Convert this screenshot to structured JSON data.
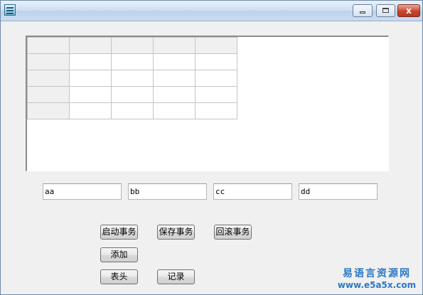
{
  "window": {
    "title": "",
    "minimize_label": "",
    "maximize_label": "",
    "close_label": "x"
  },
  "grid": {
    "columns": 5,
    "rows": 5,
    "cells": [
      [
        "",
        "",
        "",
        "",
        ""
      ],
      [
        "",
        "",
        "",
        "",
        ""
      ],
      [
        "",
        "",
        "",
        "",
        ""
      ],
      [
        "",
        "",
        "",
        "",
        ""
      ],
      [
        "",
        "",
        "",
        "",
        ""
      ]
    ]
  },
  "fields": [
    {
      "value": "aa"
    },
    {
      "value": "bb"
    },
    {
      "value": "cc"
    },
    {
      "value": "dd"
    }
  ],
  "buttons": {
    "start_transaction": "启动事务",
    "save_transaction": "保存事务",
    "rollback_transaction": "回滚事务",
    "add": "添加",
    "header": "表头",
    "record": "记录"
  },
  "watermark": {
    "line1": "易语言资源网",
    "line2": "www.e5a5x.com"
  }
}
